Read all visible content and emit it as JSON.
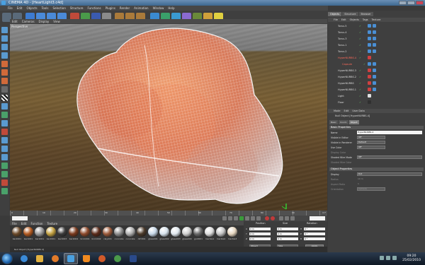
{
  "window": {
    "title": "CINEMA 4D - [HeartLight3.c4d]"
  },
  "menubar": [
    "File",
    "Edit",
    "Objects",
    "Tools",
    "Selection",
    "Structure",
    "Functions",
    "Plugins",
    "Render",
    "Animation",
    "Window",
    "Help"
  ],
  "viewport": {
    "menu": [
      "Edit",
      "Cameras",
      "Display",
      "View"
    ],
    "view_label": "Perspective"
  },
  "timeline": {
    "ticks": [
      "0",
      "10",
      "20",
      "30",
      "40",
      "50",
      "60",
      "70",
      "80",
      "90"
    ],
    "frame": "0 F"
  },
  "material_manager": {
    "menu": [
      "File",
      "Edit",
      "Function",
      "Texture"
    ],
    "materials": [
      {
        "label": "bark001",
        "color": "#6b4a2a"
      },
      {
        "label": "bark001",
        "color": "#b35a20"
      },
      {
        "label": "bark001",
        "color": "#9a9a9a"
      },
      {
        "label": "bark001",
        "color": "#c2a040"
      },
      {
        "label": "bark003",
        "color": "#3b3b3b"
      },
      {
        "label": "bark004",
        "color": "#7a3a1e"
      },
      {
        "label": "brick001",
        "color": "#8e4a2c"
      },
      {
        "label": "brick002",
        "color": "#5a2b1a"
      },
      {
        "label": "clay001",
        "color": "#9c5a3a"
      },
      {
        "label": "concrete",
        "color": "#8d8d8d"
      },
      {
        "label": "concrete",
        "color": "#b0b0b0"
      },
      {
        "label": "dirt001",
        "color": "#4b3a2a"
      },
      {
        "label": "glass001",
        "color": "#c8d8e8"
      },
      {
        "label": "glass002",
        "color": "#d8e4ee"
      },
      {
        "label": "glass003",
        "color": "#e0e8ef"
      },
      {
        "label": "glass004",
        "color": "#cfcfcf"
      },
      {
        "label": "gold001",
        "color": "#6a6a6a"
      },
      {
        "label": "marble1",
        "color": "#dcdcdc"
      },
      {
        "label": "marble2",
        "color": "#c4c4c4"
      },
      {
        "label": "marble3",
        "color": "#e6d6c0"
      }
    ]
  },
  "coordinates": {
    "headers": [
      "Position",
      "Size",
      "Rotation"
    ],
    "rows": [
      {
        "axis": "X",
        "pos": "0 m",
        "size": "0 m",
        "rot_axis": "H",
        "rot": "0 °"
      },
      {
        "axis": "Y",
        "pos": "0 m",
        "size": "0 m",
        "rot_axis": "P",
        "rot": "0 °"
      },
      {
        "axis": "Z",
        "pos": "0 m",
        "size": "0 m",
        "rot_axis": "B",
        "rot": "0 °"
      }
    ],
    "mode": "Object",
    "size_mode": "Size",
    "apply": "Apply"
  },
  "statusbar": {
    "text": "Null Object [HyperNURBS.4]"
  },
  "right_panel": {
    "tabs": [
      "Objects",
      "Structure",
      "Browser"
    ],
    "menu": [
      "File",
      "Edit",
      "Objects",
      "Tags",
      "Texture"
    ],
    "objects": [
      {
        "name": "Torus.5",
        "selected": false,
        "tag": "#4a8fd4"
      },
      {
        "name": "Torus.4",
        "selected": false,
        "tag": "#4a8fd4"
      },
      {
        "name": "Torus.3",
        "selected": false,
        "tag": "#4a8fd4"
      },
      {
        "name": "Torus.1",
        "selected": false,
        "tag": "#4a8fd4"
      },
      {
        "name": "Torus.2",
        "selected": false,
        "tag": "#4a8fd4"
      },
      {
        "name": "HyperNURBS.4",
        "selected": true,
        "tag": "#d04040"
      },
      {
        "name": "Capsule",
        "selected": true,
        "tag": "#4a8fd4"
      },
      {
        "name": "HyperNURBS.3",
        "selected": false,
        "tag": "#d04040"
      },
      {
        "name": "HyperNURBS.2",
        "selected": false,
        "tag": "#d04040"
      },
      {
        "name": "HyperNURBS",
        "selected": false,
        "tag": "#d04040"
      },
      {
        "name": "HyperNURBS.1",
        "selected": false,
        "tag": "#d04040"
      },
      {
        "name": "Light",
        "selected": false,
        "tag": "#e0e0e0"
      },
      {
        "name": "Floor",
        "selected": false,
        "tag": "#303030"
      }
    ]
  },
  "attributes": {
    "menu": [
      "Mode",
      "Edit",
      "User Data"
    ],
    "title": "Null Object [HyperNURBS.4]",
    "tabs": [
      "Basic",
      "Coord.",
      "Object"
    ],
    "basic_section": "Basic Properties",
    "basic": [
      {
        "label": "Name",
        "value": "HyperNURBS.4",
        "kind": "text"
      },
      {
        "label": "Visible in Editor",
        "value": "Off",
        "kind": "select"
      },
      {
        "label": "Visible in Renderer",
        "value": "Default",
        "kind": "select"
      },
      {
        "label": "Use Color",
        "value": "Off",
        "kind": "select"
      },
      {
        "label": "Display Color",
        "value": "",
        "kind": "dim"
      },
      {
        "label": "Shaded Wire Mode",
        "value": "Off",
        "kind": "select"
      },
      {
        "label": "Shaded Wire Color",
        "value": "",
        "kind": "dim"
      }
    ],
    "object_section": "Object Properties",
    "object": [
      {
        "label": "Display",
        "value": "Dot",
        "kind": "select"
      },
      {
        "label": "Radius",
        "value": "10 m",
        "kind": "dim"
      },
      {
        "label": "Aspect Ratio",
        "value": "1",
        "kind": "dim"
      },
      {
        "label": "Orientation",
        "value": "Camera",
        "kind": "dim"
      }
    ]
  },
  "taskbar": {
    "time": "09:20",
    "date": "25/02/2010"
  }
}
